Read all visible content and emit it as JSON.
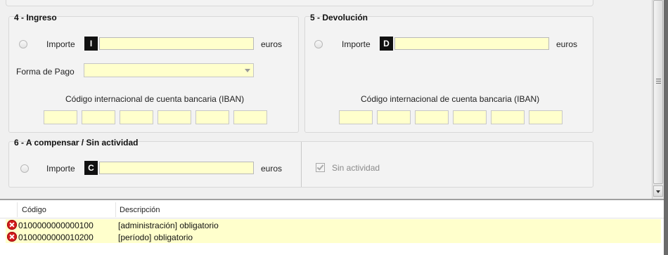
{
  "section4": {
    "legend": "4 - Ingreso",
    "importe_label": "Importe",
    "code": "I",
    "importe_value": "",
    "currency": "euros",
    "forma_pago_label": "Forma de Pago",
    "forma_pago_value": "",
    "iban_label": "Código internacional de cuenta bancaria (IBAN)",
    "iban_values": [
      "",
      "",
      "",
      "",
      "",
      ""
    ]
  },
  "section5": {
    "legend": "5 - Devolución",
    "importe_label": "Importe",
    "code": "D",
    "importe_value": "",
    "currency": "euros",
    "iban_label": "Código internacional de cuenta bancaria (IBAN)",
    "iban_values": [
      "",
      "",
      "",
      "",
      "",
      ""
    ]
  },
  "section6": {
    "legend": "6 - A compensar / Sin actividad",
    "importe_label": "Importe",
    "code": "C",
    "importe_value": "",
    "currency": "euros",
    "sin_actividad_label": "Sin actividad",
    "sin_actividad_checked": true
  },
  "errors_grid": {
    "columns": [
      "Código",
      "Descripción"
    ],
    "rows": [
      {
        "code": "0100000000000100",
        "description": "[administración] obligatorio",
        "status_icon": "error-icon"
      },
      {
        "code": "0100000000010200",
        "description": "[período] obligatorio",
        "status_icon": "error-icon"
      }
    ]
  },
  "colors": {
    "field_fill": "#ffffcc",
    "code_box": "#111111",
    "error_icon": "#d41c1c"
  }
}
